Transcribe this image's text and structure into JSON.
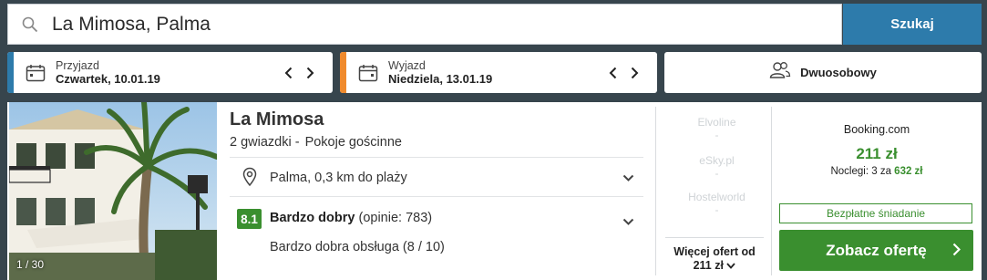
{
  "search": {
    "query": "La Mimosa, Palma",
    "button_label": "Szukaj"
  },
  "dates": {
    "checkin": {
      "label": "Przyjazd",
      "value": "Czwartek, 10.01.19",
      "accent": "#2d7bab"
    },
    "checkout": {
      "label": "Wyjazd",
      "value": "Niedziela, 13.01.19",
      "accent": "#f08a2c"
    }
  },
  "guests": {
    "value": "Dwuosobowy"
  },
  "hotel": {
    "name": "La Mimosa",
    "stars": "2 gwiazdki -",
    "type": "Pokoje gościnne",
    "photo_counter": "1 / 30",
    "location": "Palma, 0,3 km do plaży",
    "rating": {
      "score": "8.1",
      "label": "Bardzo dobry",
      "reviews": "(opinie: 783)",
      "detail": "Bardzo dobra obsługa (8 / 10)"
    }
  },
  "other_offers": {
    "providers": [
      {
        "name": "Elvoline",
        "price": "-"
      },
      {
        "name": "eSky.pl",
        "price": "-"
      },
      {
        "name": "Hostelworld",
        "price": "-"
      }
    ],
    "more_line1": "Więcej ofert od",
    "more_line2": "211 zł"
  },
  "best_offer": {
    "provider": "Booking.com",
    "price": "211 zł",
    "nights_prefix": "Noclegi: 3 za",
    "total": "632 zł",
    "badge": "Bezpłatne śniadanie",
    "cta": "Zobacz ofertę"
  },
  "colors": {
    "header_bg": "#37454d",
    "primary_blue": "#2d7bab",
    "green": "#3a8f2f",
    "orange": "#f08a2c"
  }
}
